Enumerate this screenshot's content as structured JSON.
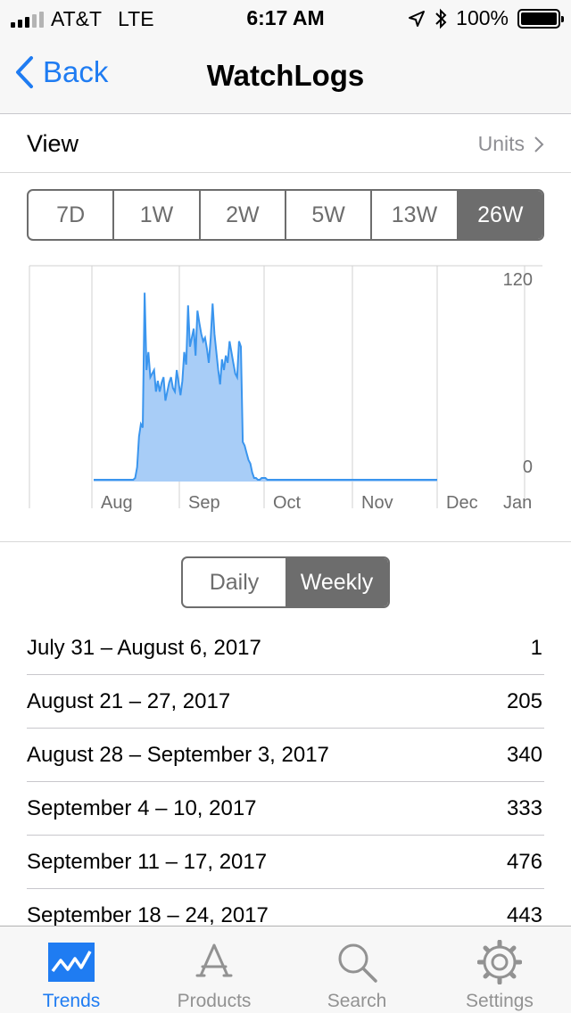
{
  "status_bar": {
    "carrier": "AT&T",
    "network": "LTE",
    "time": "6:17 AM",
    "battery": "100%"
  },
  "nav": {
    "back_label": "Back",
    "title": "WatchLogs"
  },
  "view_row": {
    "label": "View",
    "units_label": "Units"
  },
  "range_options": [
    "7D",
    "1W",
    "2W",
    "5W",
    "13W",
    "26W"
  ],
  "range_selected": "26W",
  "chart_data": {
    "type": "area",
    "x_labels": [
      "Aug",
      "Sep",
      "Oct",
      "Nov",
      "Dec",
      "Jan"
    ],
    "y_ticks": [
      "120",
      "0"
    ],
    "ylim": [
      0,
      120
    ],
    "x": [
      0,
      1,
      2,
      3,
      4,
      5,
      6,
      7,
      8,
      9,
      10,
      11,
      12,
      13,
      14,
      15,
      16,
      17,
      18,
      19,
      20,
      21,
      22,
      23,
      24,
      25,
      26,
      27,
      28,
      29,
      30,
      31,
      32,
      33,
      34,
      35,
      36,
      37,
      38,
      39,
      40,
      41,
      42,
      43,
      44,
      45,
      46,
      47,
      48,
      49,
      50,
      51,
      52,
      53,
      54,
      55,
      56,
      57,
      58,
      59,
      60,
      61,
      62,
      63,
      64,
      65,
      66,
      67,
      68,
      69,
      70,
      71,
      72,
      73,
      74,
      75,
      76,
      77,
      78,
      79,
      80,
      81,
      82,
      83,
      84,
      85,
      86,
      87,
      88,
      89,
      90,
      91,
      92,
      93,
      94,
      95,
      96,
      97,
      98,
      99,
      100,
      101,
      102,
      103,
      104,
      105,
      106,
      107,
      108,
      109,
      110,
      111,
      112,
      113,
      114,
      115,
      116,
      117,
      118,
      119,
      120,
      121,
      122,
      123,
      124,
      125,
      126,
      127,
      128,
      129,
      130,
      131,
      132,
      133,
      134,
      135,
      136,
      137,
      138,
      139,
      140,
      141,
      142,
      143,
      144,
      145,
      146,
      147,
      148,
      149,
      150,
      151,
      152,
      153,
      154,
      155,
      156,
      157,
      158,
      159,
      160,
      161,
      162,
      163,
      164,
      165,
      166,
      167,
      168,
      169,
      170,
      171,
      172,
      173,
      174,
      175,
      176,
      177,
      178,
      179,
      180,
      181,
      182
    ],
    "series": [
      {
        "values": [
          1,
          1,
          1,
          1,
          1,
          1,
          1,
          1,
          1,
          1,
          1,
          1,
          1,
          1,
          1,
          1,
          1,
          1,
          1,
          1,
          1,
          1,
          2,
          8,
          25,
          32,
          30,
          105,
          62,
          72,
          58,
          60,
          62,
          50,
          56,
          50,
          55,
          58,
          45,
          50,
          55,
          58,
          52,
          50,
          62,
          55,
          48,
          56,
          72,
          65,
          98,
          75,
          80,
          85,
          70,
          95,
          88,
          82,
          78,
          80,
          74,
          66,
          80,
          99,
          82,
          72,
          62,
          54,
          68,
          62,
          70,
          66,
          78,
          72,
          66,
          60,
          58,
          78,
          75,
          22,
          20,
          16,
          12,
          10,
          5,
          2,
          2,
          1,
          1,
          2,
          2,
          2,
          1,
          1,
          1,
          1,
          1,
          1,
          1,
          1,
          1,
          1,
          1,
          1,
          1,
          1,
          1,
          1,
          1,
          1,
          1,
          1,
          1,
          1,
          1,
          1,
          1,
          1,
          1,
          1,
          1,
          1,
          1,
          1,
          1,
          1,
          1,
          1,
          1,
          1,
          1,
          1,
          1,
          1,
          1,
          1,
          1,
          1,
          1,
          1,
          1,
          1,
          1,
          1,
          1,
          1,
          1,
          1,
          1,
          1,
          1,
          1,
          1,
          1,
          1,
          1,
          1,
          1,
          1,
          1,
          1,
          1,
          1,
          1,
          1,
          1,
          1,
          1,
          1,
          1,
          1,
          1,
          1,
          1,
          1,
          1,
          1,
          1,
          1,
          1,
          1,
          1,
          1
        ],
        "color": "#3a95ee"
      }
    ],
    "grid": true
  },
  "period_options": [
    "Daily",
    "Weekly"
  ],
  "period_selected": "Weekly",
  "weekly_rows": [
    {
      "range": "July 31 – August 6, 2017",
      "value": "1"
    },
    {
      "range": "August 21 – 27, 2017",
      "value": "205"
    },
    {
      "range": "August 28 – September 3, 2017",
      "value": "340"
    },
    {
      "range": "September 4 – 10, 2017",
      "value": "333"
    },
    {
      "range": "September 11 – 17, 2017",
      "value": "476"
    },
    {
      "range": "September 18 – 24, 2017",
      "value": "443"
    }
  ],
  "tabs": [
    {
      "label": "Trends",
      "icon": "trends-icon",
      "active": true
    },
    {
      "label": "Products",
      "icon": "products-icon",
      "active": false
    },
    {
      "label": "Search",
      "icon": "search-icon",
      "active": false
    },
    {
      "label": "Settings",
      "icon": "settings-gear-icon",
      "active": false
    }
  ],
  "colors": {
    "accent": "#1f7cf2",
    "segment": "#6d6d6d",
    "chart_fill": "#a8cdf7",
    "chart_line": "#3a95ee"
  }
}
